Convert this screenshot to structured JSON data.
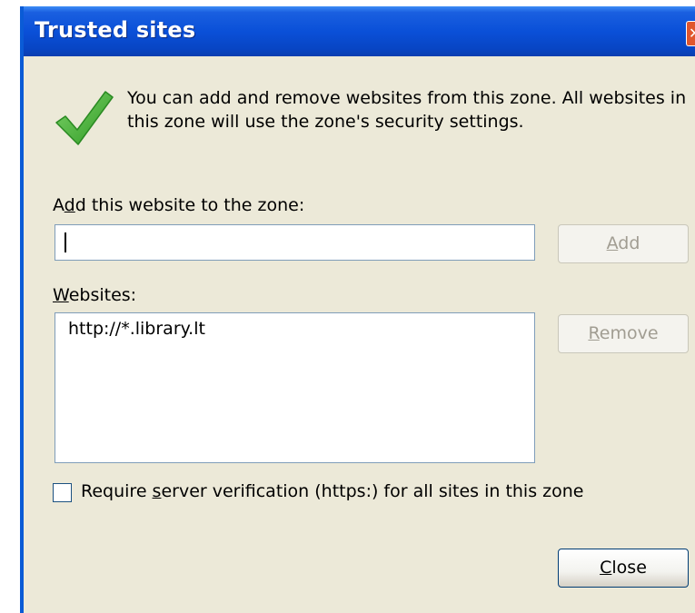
{
  "window": {
    "title": "Trusted sites"
  },
  "intro": {
    "text": "You can add and remove websites from this zone. All websites in this zone will use the zone's security settings."
  },
  "add_section": {
    "label_pre": "A",
    "label_accel": "d",
    "label_post": "d this website to the zone:",
    "input_value": "",
    "add_button_accel": "A",
    "add_button_rest": "dd",
    "add_button_enabled": false
  },
  "websites_section": {
    "label_accel": "W",
    "label_rest": "ebsites:",
    "items": [
      "http://*.library.lt"
    ],
    "remove_button_accel": "R",
    "remove_button_rest": "emove",
    "remove_button_enabled": false
  },
  "verification": {
    "checked": false,
    "label_pre": "Require ",
    "label_accel": "s",
    "label_post": "erver verification (https:) for all sites in this zone"
  },
  "footer": {
    "close_accel": "C",
    "close_rest": "lose"
  },
  "colors": {
    "titlebar": "#0a50d8",
    "dialog_bg": "#ece9d8",
    "checkmark_green": "#3bab2b",
    "close_x": "#e0562e"
  },
  "icons": {
    "intro_icon": "green-checkmark-icon",
    "window_close": "close-icon"
  }
}
